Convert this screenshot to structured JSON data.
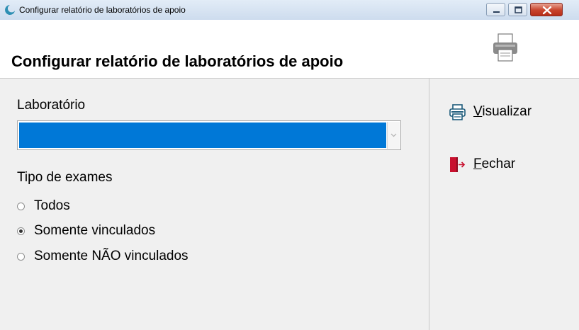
{
  "window": {
    "title": "Configurar relatório de laboratórios de apoio",
    "controls": [
      "minimize",
      "maximize",
      "close"
    ]
  },
  "header": {
    "title": "Configurar relatório de laboratórios de apoio",
    "icon": "printer-icon"
  },
  "form": {
    "laboratorio_label": "Laboratório",
    "laboratorio_value": "",
    "tipo_label": "Tipo de exames",
    "options": [
      {
        "label": "Todos",
        "checked": false
      },
      {
        "label": "Somente vinculados",
        "checked": true
      },
      {
        "label": "Somente NÃO vinculados",
        "checked": false
      }
    ]
  },
  "actions": {
    "visualizar": {
      "mnemonic": "V",
      "rest": "isualizar",
      "icon": "printer-icon"
    },
    "fechar": {
      "mnemonic": "F",
      "rest": "echar",
      "icon": "exit-door-icon"
    }
  },
  "colors": {
    "selection": "#0078d7",
    "exit_icon": "#c8102e",
    "icon_blue": "#1c5a7a"
  }
}
